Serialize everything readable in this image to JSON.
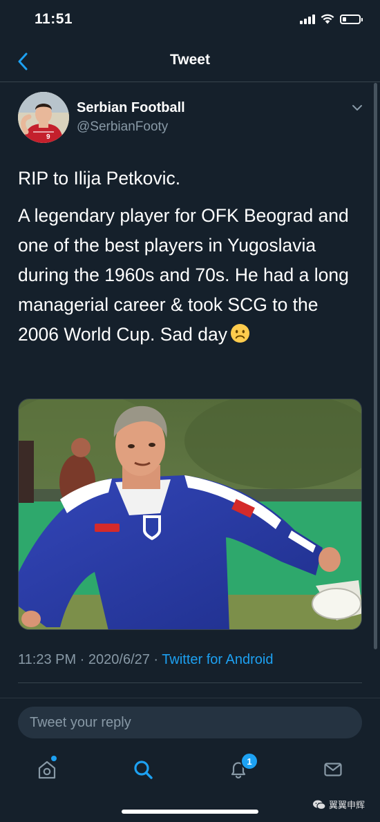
{
  "status_bar": {
    "time": "11:51",
    "icons": [
      "cellular-signal-icon",
      "wifi-icon",
      "battery-icon"
    ]
  },
  "header": {
    "title": "Tweet",
    "back_icon": "chevron-left-icon"
  },
  "tweet": {
    "author": {
      "name": "Serbian Football",
      "handle": "@SerbianFooty"
    },
    "text": {
      "line1": "RIP to Ilija Petkovic.",
      "line2": "A legendary player for OFK Beograd and one of the best players in Yugoslavia during the 1960s and 70s. He had a long managerial career & took SCG to the 2006 World Cup. Sad day",
      "emoji": "frowning-face"
    },
    "meta": {
      "timestamp": "11:23 PM · 2020/6/27 · ",
      "source": "Twitter for Android"
    }
  },
  "reply": {
    "placeholder": "Tweet your reply"
  },
  "tab_bar": {
    "tabs": [
      {
        "name": "home",
        "icon": "home-icon"
      },
      {
        "name": "search",
        "icon": "search-icon"
      },
      {
        "name": "notifications",
        "icon": "bell-icon",
        "badge": "1"
      },
      {
        "name": "messages",
        "icon": "mail-icon"
      }
    ]
  },
  "watermark": {
    "text": "翼翼申辉"
  },
  "colors": {
    "background": "#15202b",
    "accent": "#1da1f2",
    "secondary_text": "#8899a6",
    "divider": "#38444d"
  }
}
